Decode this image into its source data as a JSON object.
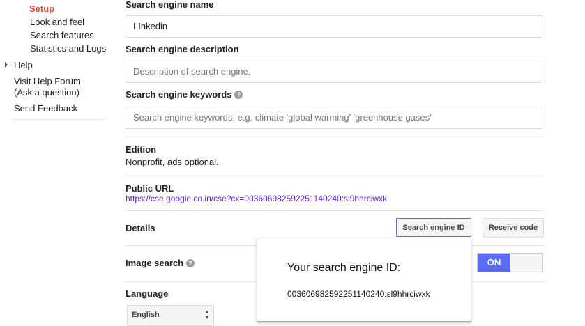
{
  "sidebar": {
    "items": [
      {
        "label": "Setup"
      },
      {
        "label": "Look and feel"
      },
      {
        "label": "Search features"
      },
      {
        "label": "Statistics and Logs"
      }
    ],
    "help": "Help",
    "forum": "Visit Help Forum",
    "forum_sub": "(Ask a question)",
    "feedback": "Send Feedback"
  },
  "form": {
    "name_label": "Search engine name",
    "name_value": "LInkedin",
    "desc_label": "Search engine description",
    "desc_placeholder": "Description of search engine.",
    "kw_label": "Search engine keywords",
    "kw_placeholder": "Search engine keywords, e.g. climate 'global warming' 'greenhouse gases'",
    "edition_label": "Edition",
    "edition_value": "Nonprofit, ads optional.",
    "url_label": "Public URL",
    "url_value": "https://cse.google.co.in/cse?cx=003606982592251140240:sl9hhrciwxk",
    "details_label": "Details",
    "id_button": "Search engine ID",
    "code_button": "Receive code",
    "image_label": "Image search",
    "image_toggle": "ON",
    "lang_label": "Language",
    "lang_value": "English"
  },
  "popup": {
    "title": "Your search engine ID:",
    "id": "003606982592251140240:sl9hhrciwxk"
  },
  "colors": {
    "accent": "#dd4b39",
    "toggle": "#5b6bf5",
    "link": "#5a1fd6"
  }
}
